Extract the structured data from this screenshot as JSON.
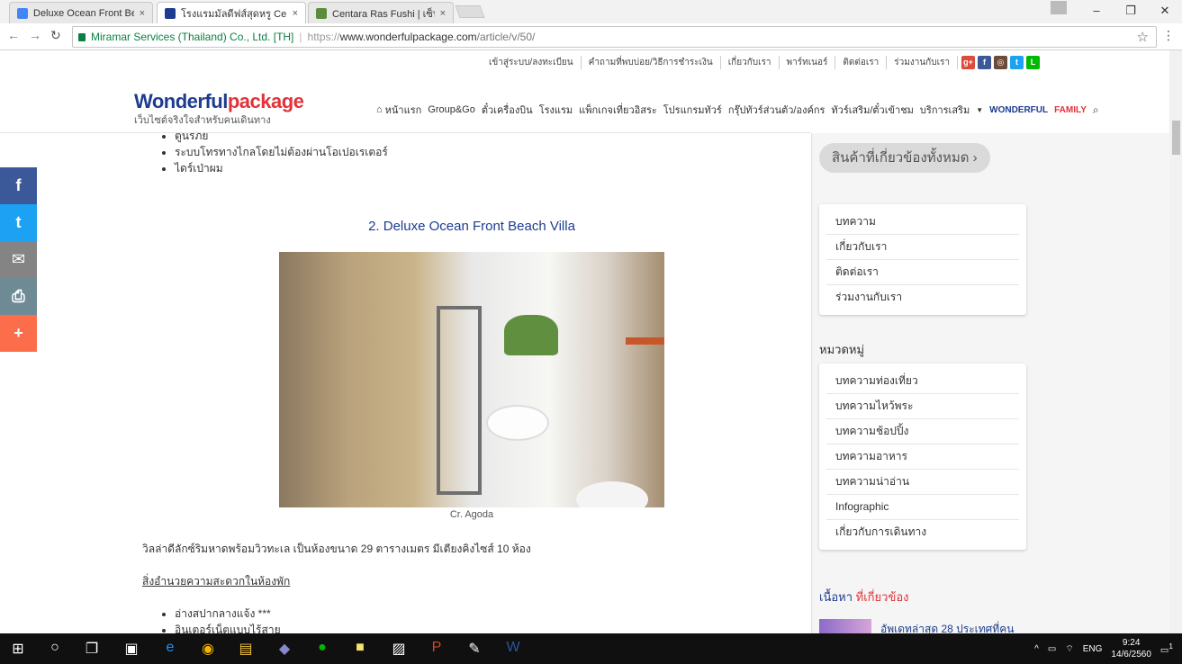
{
  "browser": {
    "tabs": [
      {
        "label": "Deluxe Ocean Front Beac",
        "favicon_color": "#4285f4"
      },
      {
        "label": "โรงแรมมัลดีฟส์สุดหรู Centar",
        "favicon_color": "#1d3c8f"
      },
      {
        "label": "Centara Ras Fushi | เซ็นเท",
        "favicon_color": "#5b8c3a"
      }
    ],
    "secure_label": "Miramar Services (Thailand) Co., Ltd. [TH]",
    "url_prefix": "https://",
    "url_host": "www.wonderfulpackage.com",
    "url_path": "/article/v/50/"
  },
  "site": {
    "top_links": [
      "เข้าสู่ระบบ/ลงทะเบียน",
      "คำถามที่พบบ่อย/วิธีการชำระเงิน",
      "เกี่ยวกับเรา",
      "พาร์ทเนอร์",
      "ติดต่อเรา",
      "ร่วมงานกับเรา"
    ],
    "logo_main": "Wonderful",
    "logo_accent": "package",
    "logo_tagline": "เว็บไซต์จริงใจสำหรับคนเดินทาง",
    "nav": [
      "หน้าแรก",
      "Group&Go",
      "ตั๋วเครื่องบิน",
      "โรงแรม",
      "แพ็กเกจเที่ยวอิสระ",
      "โปรแกรมทัวร์",
      "กรุ๊ปทัวร์ส่วนตัว/องค์กร",
      "ทัวร์เสริม/ตั๋วเข้าชม",
      "บริการเสริม"
    ],
    "nav_family_a": "WONDERFUL",
    "nav_family_b": "FAMILY"
  },
  "share": [
    "f",
    "t",
    "✉",
    "⎙",
    "+"
  ],
  "article": {
    "top_bullets": [
      "ตู้นิรภัย",
      "ระบบโทรทางไกลโดยไม่ต้องผ่านโอเปอเรเตอร์",
      "ไดร์เป่าผม"
    ],
    "heading": "2. Deluxe Ocean Front Beach Villa",
    "caption": "Cr. Agoda",
    "paragraph": "วิลล่าดีลักซ์ริมหาดพร้อมวิวทะเล เป็นห้องขนาด 29 ตารางเมตร มีเตียงคิงไซส์ 10 ห้อง",
    "facilities_title": "สิ่งอำนวยความสะดวกในห้องพัก",
    "bottom_bullets": [
      "อ่างสปากลางแจ้ง ***",
      "อินเตอร์เน็ตแบบไร้สาย"
    ]
  },
  "sidebar": {
    "all_products": "สินค้าที่เกี่ยวข้องทั้งหมด",
    "links": [
      "บทความ",
      "เกี่ยวกับเรา",
      "ติดต่อเรา",
      "ร่วมงานกับเรา"
    ],
    "category_title": "หมวดหมู่",
    "categories": [
      "บทความท่องเที่ยว",
      "บทความไหว้พระ",
      "บทความช้อปปิ้ง",
      "บทความอาหาร",
      "บทความน่าอ่าน",
      "Infographic",
      "เกี่ยวกับการเดินทาง"
    ],
    "related_a": "เนื้อหา",
    "related_b": "ที่เกี่ยวข้อง",
    "related_item": "อัพเดทล่าสุด 28 ประเทศที่คน"
  },
  "taskbar": {
    "lang": "ENG",
    "time": "9:24",
    "date": "14/6/2560",
    "notifications": "1"
  }
}
